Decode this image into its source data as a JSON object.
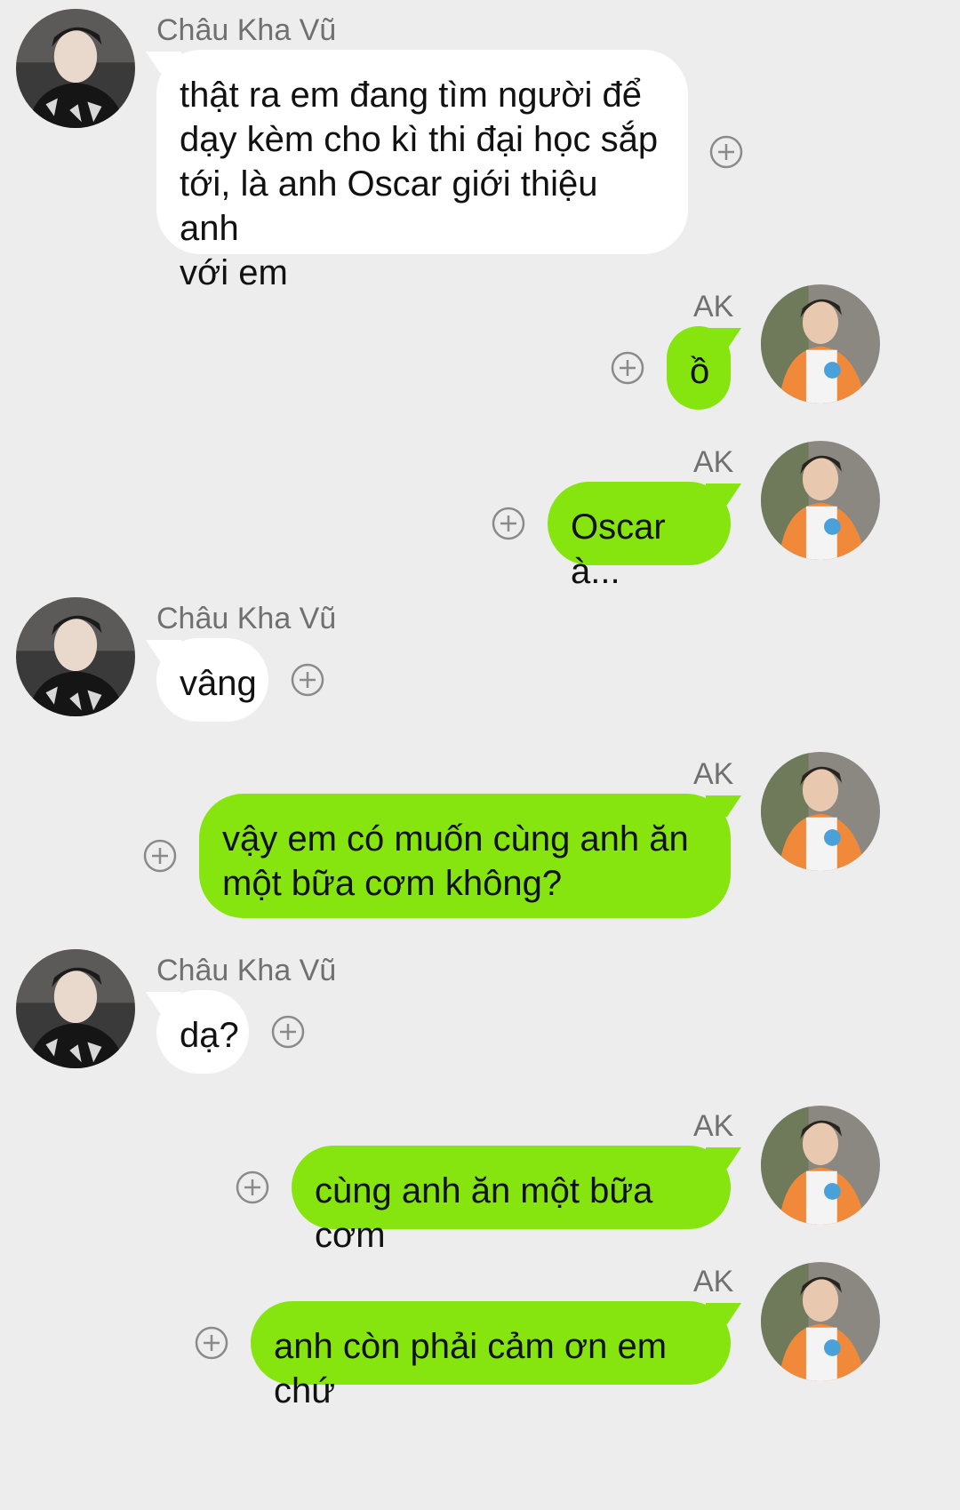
{
  "participants": {
    "left": {
      "name": "Châu Kha Vũ",
      "avatar_icon": "avatar-dark-outfit-icon"
    },
    "right": {
      "name": "AK",
      "avatar_icon": "avatar-orange-shirt-icon"
    }
  },
  "colors": {
    "background": "#ededed",
    "incoming_bubble": "#ffffff",
    "outgoing_bubble": "#86e40f",
    "plus_icon": "#8a8a8a"
  },
  "messages": [
    {
      "sender": "Châu Kha Vũ",
      "side": "left",
      "text": "thật ra em đang tìm người để\ndạy kèm cho kì thi đại học sắp\ntới, là anh Oscar giới thiệu anh\nvới em"
    },
    {
      "sender": "AK",
      "side": "right",
      "text": "ồ"
    },
    {
      "sender": "AK",
      "side": "right",
      "text": "Oscar à..."
    },
    {
      "sender": "Châu Kha Vũ",
      "side": "left",
      "text": "vâng"
    },
    {
      "sender": "AK",
      "side": "right",
      "text": "vậy em có muốn cùng anh ăn\nmột bữa cơm không?"
    },
    {
      "sender": "Châu Kha Vũ",
      "side": "left",
      "text": "dạ?"
    },
    {
      "sender": "AK",
      "side": "right",
      "text": "cùng anh ăn một bữa cơm"
    },
    {
      "sender": "AK",
      "side": "right",
      "text": "anh còn phải cảm ơn em chứ"
    }
  ]
}
